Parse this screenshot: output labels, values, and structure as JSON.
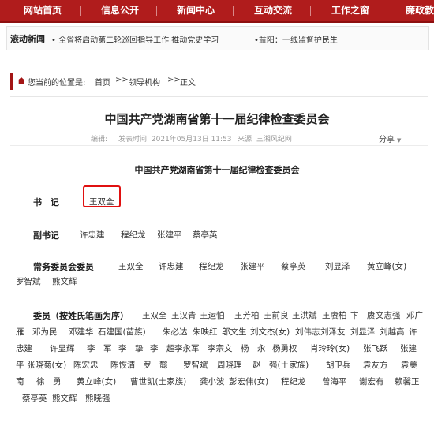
{
  "nav": {
    "items": [
      "网站首页",
      "信息公开",
      "新闻中心",
      "互动交流",
      "工作之窗",
      "廉政教"
    ]
  },
  "ticker": {
    "label": "滚动新闻",
    "news": [
      "• 全省将启动第二轮巡回指导工作 推动党史学习",
      "•益阳：一线监督护民生"
    ]
  },
  "breadcrumb": {
    "prefix": "您当前的位置是:",
    "links": [
      "首页",
      "领导机构",
      "正文"
    ],
    "separator": ">>"
  },
  "article": {
    "title": "中国共产党湖南省第十一届纪律检查委员会",
    "meta": {
      "editor": "编辑:",
      "time": "发表时间: 2021年05月13日 11:53",
      "source": "来源: 三湘风纪网"
    },
    "share": "分享"
  },
  "content": {
    "subtitle": "中国共产党湖南省第十一届纪律检查委员会",
    "secretary": {
      "label": "书　记",
      "names": [
        "王双全"
      ]
    },
    "deputy": {
      "label": "副书记",
      "names": [
        "许忠建",
        "程纪龙",
        "张建平",
        "蔡亭英"
      ]
    },
    "standing": {
      "label": "常务委员会委员",
      "names": [
        "王双全",
        "许忠建",
        "程纪龙",
        "张建平",
        "蔡亭英",
        "刘显泽",
        "黄立峰(女)",
        "罗智斌",
        "熊文辉"
      ]
    },
    "members": {
      "label": "委员（按姓氏笔画为序）",
      "lines": [
        [
          "王双全",
          "王汉青",
          "王运怕",
          "王芳柏",
          "王前良",
          "王洪斌",
          "王赓柏",
          "卞　赓",
          "文志强",
          "邓广"
        ],
        [
          "雁",
          "邓为民",
          "邓建华",
          "石建国(苗族)",
          "朱必达",
          "朱映红",
          "邬文生",
          "刘文杰(女)",
          "刘伟志",
          "刘泽友",
          "刘显泽",
          "刘越高",
          "许"
        ],
        [
          "忠建",
          "许显辉",
          "李　军",
          "李　挚",
          "李　超",
          "李永军",
          "李宗文",
          "杨　永",
          "杨勇权",
          "肖玲玲(女)",
          "张飞跃",
          "张建"
        ],
        [
          "平",
          "张晓菊(女)",
          "陈宏忠",
          "陈恢清",
          "罗　懿",
          "罗智斌",
          "周晓理",
          "赵　强(土家族)",
          "胡卫兵",
          "袁友方",
          "袁美"
        ],
        [
          "南",
          "徐　勇",
          "黄立峰(女)",
          "曹世凯(土家族)",
          "龚小波",
          "彭宏伟(女)",
          "程纪龙",
          "曾海平",
          "谢宏有",
          "赖馨正"
        ],
        [
          "蔡亭英",
          "熊文辉",
          "熊晓强"
        ]
      ]
    }
  }
}
